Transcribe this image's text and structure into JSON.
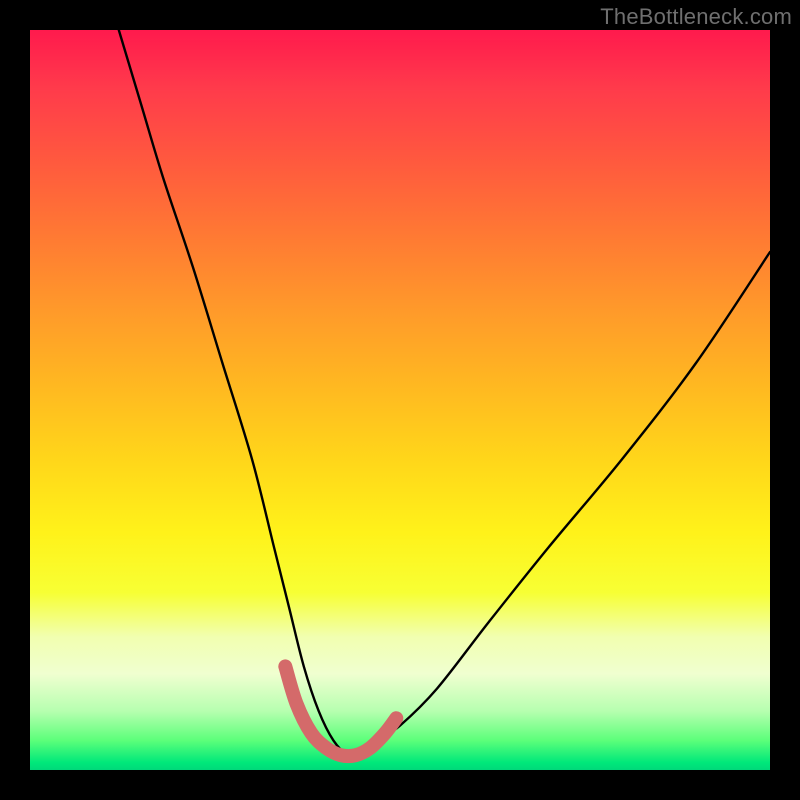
{
  "watermark": "TheBottleneck.com",
  "chart_data": {
    "type": "line",
    "title": "",
    "xlabel": "",
    "ylabel": "",
    "xlim": [
      0,
      100
    ],
    "ylim": [
      0,
      100
    ],
    "grid": false,
    "legend": false,
    "annotations": [],
    "series": [
      {
        "name": "bottleneck-curve",
        "x": [
          12,
          15,
          18,
          22,
          26,
          30,
          33,
          35,
          37,
          39,
          41,
          43,
          45,
          47,
          50,
          55,
          62,
          70,
          80,
          90,
          100
        ],
        "y": [
          100,
          90,
          80,
          68,
          55,
          42,
          30,
          22,
          14,
          8,
          4,
          2,
          2,
          4,
          6,
          11,
          20,
          30,
          42,
          55,
          70
        ]
      },
      {
        "name": "highlight-trough",
        "x": [
          34.5,
          36,
          38,
          40,
          42,
          44,
          46,
          48,
          49.5
        ],
        "y": [
          14,
          9,
          5,
          3,
          2,
          2,
          3,
          5,
          7
        ]
      }
    ],
    "gradient_stops": [
      {
        "pos": 0.0,
        "color": "#ff1a4d"
      },
      {
        "pos": 0.08,
        "color": "#ff3b4b"
      },
      {
        "pos": 0.18,
        "color": "#ff5a3e"
      },
      {
        "pos": 0.28,
        "color": "#ff7a33"
      },
      {
        "pos": 0.38,
        "color": "#ff9a2a"
      },
      {
        "pos": 0.48,
        "color": "#ffb821"
      },
      {
        "pos": 0.58,
        "color": "#ffd61a"
      },
      {
        "pos": 0.68,
        "color": "#fff21a"
      },
      {
        "pos": 0.76,
        "color": "#f7ff34"
      },
      {
        "pos": 0.82,
        "color": "#f1ffb0"
      },
      {
        "pos": 0.87,
        "color": "#f0ffd0"
      },
      {
        "pos": 0.92,
        "color": "#b7ffb0"
      },
      {
        "pos": 0.96,
        "color": "#5cff7a"
      },
      {
        "pos": 0.99,
        "color": "#00e87a"
      },
      {
        "pos": 1.0,
        "color": "#00d87a"
      }
    ],
    "curve_colors": {
      "main": "#000000",
      "highlight": "#d46a6a"
    }
  }
}
